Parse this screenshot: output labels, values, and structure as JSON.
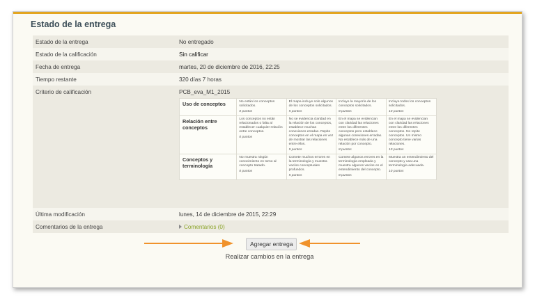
{
  "section_title": "Estado de la entrega",
  "rows": {
    "estado_entrega": {
      "label": "Estado de la entrega",
      "value": "No entregado"
    },
    "estado_calificacion": {
      "label": "Estado de la calificación",
      "value": "Sin calificar"
    },
    "fecha_entrega": {
      "label": "Fecha de entrega",
      "value": "martes, 20 de diciembre de 2016, 22:25"
    },
    "tiempo_restante": {
      "label": "Tiempo restante",
      "value": "320 días 7 horas"
    },
    "criterio": {
      "label": "Criterio de calificación",
      "value": "PCB_eva_M1_2015"
    },
    "ultima_modificacion": {
      "label": "Última modificación",
      "value": "lunes, 14 de diciembre de 2015, 22:29"
    },
    "comentarios": {
      "label": "Comentarios de la entrega",
      "value": "Comentarios (0)"
    }
  },
  "rubric": [
    {
      "criterion": "Uso de conceptos",
      "levels": [
        {
          "text": "No están los conceptos solicitados.",
          "points": "0 puntos"
        },
        {
          "text": "El mapa incluye solo algunos de los conceptos solicitados.",
          "points": "5 puntos"
        },
        {
          "text": "Incluye la mayoría de los conceptos solicitados.",
          "points": "8 puntos"
        },
        {
          "text": "Incluye todos los conceptos solicitados.",
          "points": "10 puntos"
        }
      ]
    },
    {
      "criterion": "Relación entre conceptos",
      "levels": [
        {
          "text": "Los conceptos no están relacionados o falta al establecer cualquier relación entre conceptos.",
          "points": "0 puntos"
        },
        {
          "text": "No se evidencia claridad en la relación de los conceptos, establece muchas conexiones erradas. Repite conceptos en el mapa en vez de mostrar las relaciones entre ellos.",
          "points": "5 puntos"
        },
        {
          "text": "En el mapa se evidencian con claridad las relaciones entre los diferentes conceptos pero establece algunas conexiones erradas. No establece más de una relación por concepto.",
          "points": "8 puntos"
        },
        {
          "text": "En el mapa se evidencian con claridad las relaciones entre los diferentes conceptos. No repite conceptos. Un mismo concepto tiene varias relaciones.",
          "points": "10 puntos"
        }
      ]
    },
    {
      "criterion": "Conceptos y terminología",
      "levels": [
        {
          "text": "No muestra ningún conocimiento en torno al concepto tratado.",
          "points": "0 puntos"
        },
        {
          "text": "Comete muchos errores en la terminología y muestra vacíos conceptuales profundos.",
          "points": "5 puntos"
        },
        {
          "text": "Comete algunos errores en la terminología empleada y muestra algunos vacíos en el entendimiento del concepto.",
          "points": "8 puntos"
        },
        {
          "text": "Muestra un entendimiento del concepto y usa una terminología adecuada.",
          "points": "10 puntos"
        }
      ]
    }
  ],
  "action": {
    "button_label": "Agregar entrega",
    "caption": "Realizar cambios en la entrega"
  },
  "colors": {
    "accent_bar": "#e3a51f",
    "arrow": "#f0922b",
    "link": "#8aa327"
  },
  "icons": {
    "comment_toggle": "triangle-right-icon"
  }
}
